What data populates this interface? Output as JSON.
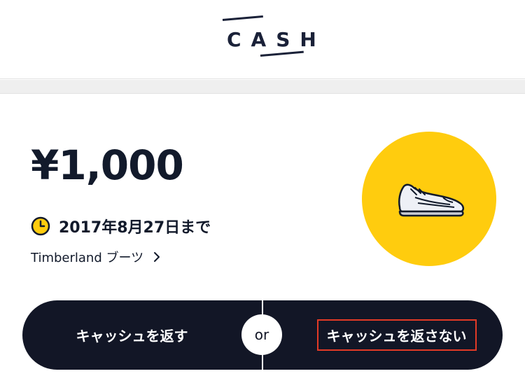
{
  "header": {
    "logo_text": "CASH"
  },
  "offer": {
    "price": "¥1,000",
    "deadline": "2017年8月27日まで",
    "deadline_icon": "clock-icon",
    "product_label": "Timberland ブーツ",
    "product_chevron_icon": "chevron-right-icon",
    "item_icon": "sneaker-icon"
  },
  "actions": {
    "return_label": "キャッシュを返す",
    "separator": "or",
    "keep_label": "キャッシュを返さない"
  },
  "colors": {
    "navy": "#121626",
    "accent_yellow": "#ffcc0e",
    "highlight_red": "#e23a26",
    "divider_gray": "#efefef"
  }
}
